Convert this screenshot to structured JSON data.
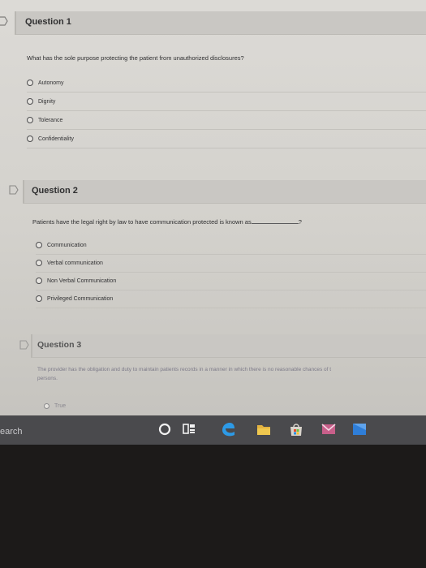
{
  "questions": [
    {
      "title": "Question 1",
      "prompt": "What has the sole purpose protecting the patient from unauthorized disclosures?",
      "options": [
        "Autonomy",
        "Dignity",
        "Tolerance",
        "Confidentiality"
      ]
    },
    {
      "title": "Question 2",
      "prompt_before": "Patients have the legal right by law to have communication protected is known as",
      "prompt_after": "?",
      "options": [
        "Communication",
        "Verbal communication",
        "Non Verbal Communication",
        "Privileged Communication"
      ]
    },
    {
      "title": "Question 3",
      "prompt_line1": "The provider has the obligation and duty to maintain patients records in a manner in which there is no reasonable chances of t",
      "prompt_line2": "persons.",
      "options": [
        "True"
      ]
    }
  ],
  "taskbar": {
    "search_text": "earch",
    "icons": [
      "cortana-circle-icon",
      "task-view-icon",
      "edge-icon",
      "file-explorer-icon",
      "store-icon",
      "mail-icon",
      "app-icon"
    ]
  }
}
